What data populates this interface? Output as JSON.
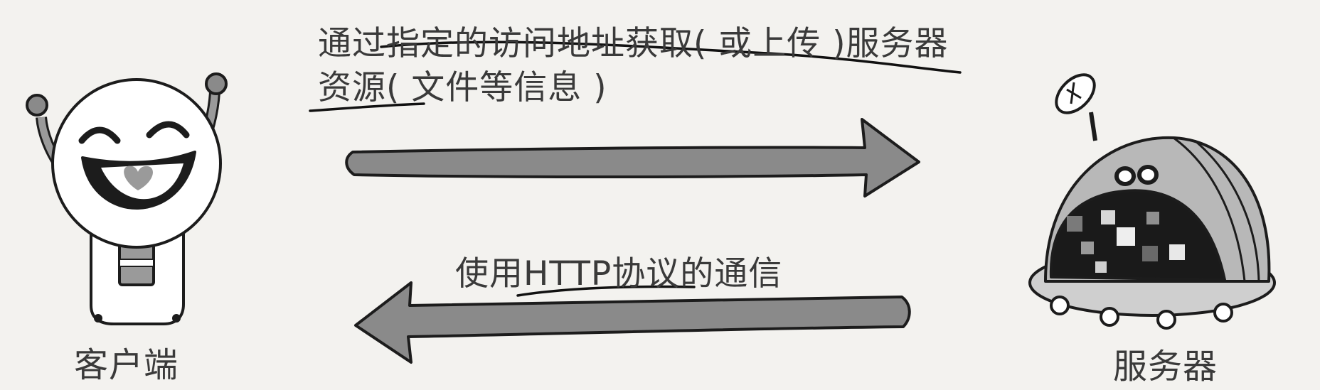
{
  "request_text": {
    "line1": "通过指定的访问地址获取( 或上传 )服务器",
    "line2": "资源( 文件等信息 )"
  },
  "protocol_label": "使用HTTP协议的通信",
  "client": {
    "label": "客户端"
  },
  "server": {
    "label": "服务器"
  },
  "colors": {
    "background": "#f3f2ef",
    "arrow_fill": "#8a8a8a",
    "outline": "#1c1c1c",
    "heart": "#9a9a9a",
    "server_shell": "#b8b8b8",
    "server_screen": "#1a1a1a"
  }
}
